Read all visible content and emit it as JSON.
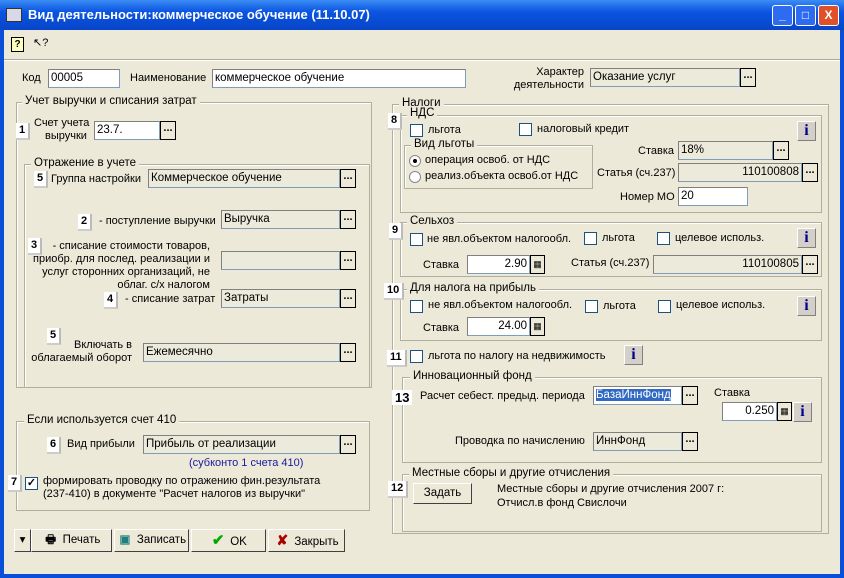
{
  "window": {
    "title": "Вид деятельности:коммерческое обучение (11.10.07)",
    "minimize": "_",
    "maximize": "□",
    "close": "X"
  },
  "toolbar": {
    "help": "?",
    "whats_this": "↖?"
  },
  "header": {
    "code_label": "Код",
    "code": "00005",
    "name_label": "Наименование",
    "name": "коммерческое обучение",
    "char_label_1": "Характер",
    "char_label_2": "деятельности",
    "char_value": "Оказание услуг"
  },
  "left": {
    "group_title": "Учет выручки и списания затрат",
    "b1": "1",
    "account_label_1": "Счет учета",
    "account_label_2": "выручки",
    "account": "23.7.",
    "refl_title": "Отражение в учете",
    "b5": "5",
    "group_label": "Группа настройки",
    "group_value": "Коммерческое обучение",
    "b2": "2",
    "revenue_label": "- поступление выручки",
    "revenue_value": "Выручка",
    "b3": "3",
    "goods_label_1": "- списание стоимости товаров,",
    "goods_label_2": "приобр. для послед. реализации и",
    "goods_label_3": "услуг сторонних организаций, не",
    "goods_label_4": "облаг. с/х налогом",
    "goods_value": "",
    "b4": "4",
    "costs_label": "- списание затрат",
    "costs_value": "Затраты",
    "b5b": "5",
    "turnover_label_1": "Включать в",
    "turnover_label_2": "облагаемый оборот",
    "turnover_value": "Ежемесячно",
    "g410_title": "Если используется счет 410",
    "b6": "6",
    "profit_label": "Вид прибыли",
    "profit_value": "Прибыль от реализации",
    "subconto": "(субконто 1 счета 410)",
    "b7": "7",
    "post_checked": true,
    "post_label_1": "формировать проводку по отражению фин.результата",
    "post_label_2": "(237-410) в документе \"Расчет налогов из выручки\""
  },
  "taxes": {
    "title": "Налоги",
    "vat": {
      "badge": "8",
      "title": "НДС",
      "benefit": "льгота",
      "credit": "налоговый кредит",
      "kind_title": "Вид льготы",
      "radio1": "операция освоб. от НДС",
      "radio2": "реализ.объекта освоб.от НДС",
      "rate_label": "Ставка",
      "rate": "18%",
      "article_label": "Статья (сч.237)",
      "article": "110100808",
      "mo_label": "Номер МО",
      "mo": "20"
    },
    "agri": {
      "badge": "9",
      "title": "Сельхоз",
      "not_object": "не явл.объектом налогообл.",
      "benefit": "льгота",
      "target": "целевое использ.",
      "rate_label": "Ставка",
      "rate": "2.90",
      "article_label": "Статья (сч.237)",
      "article": "110100805"
    },
    "profit": {
      "badge": "10",
      "title": "Для налога на прибыль",
      "not_object": "не явл.объектом налогообл.",
      "benefit": "льгота",
      "target": "целевое использ.",
      "rate_label": "Ставка",
      "rate": "24.00"
    },
    "realty": {
      "badge": "11",
      "label": "льгота по налогу на недвижимость"
    },
    "innov": {
      "badge": "13",
      "title": "Инновационный фонд",
      "calc_label": "Расчет себест. предыд. периода",
      "calc_value": "БазаИннФонд",
      "rate_label": "Ставка",
      "rate": "0.250",
      "posting_label": "Проводка по начислению",
      "posting_value": "ИннФонд"
    },
    "local": {
      "badge": "12",
      "title": "Местные сборы и другие отчисления",
      "set_button": "Задать",
      "line1": "Местные сборы и другие отчисления 2007 г:",
      "line2": "Отчисл.в фонд Свислочи"
    }
  },
  "buttons": {
    "print": "Печать",
    "save": "Записать",
    "ok": "OK",
    "close": "Закрыть"
  },
  "colors": {
    "titlebar": "#0a54e0",
    "face": "#ece9d8",
    "link": "#1a1aa0",
    "selection": "#316ac5"
  }
}
